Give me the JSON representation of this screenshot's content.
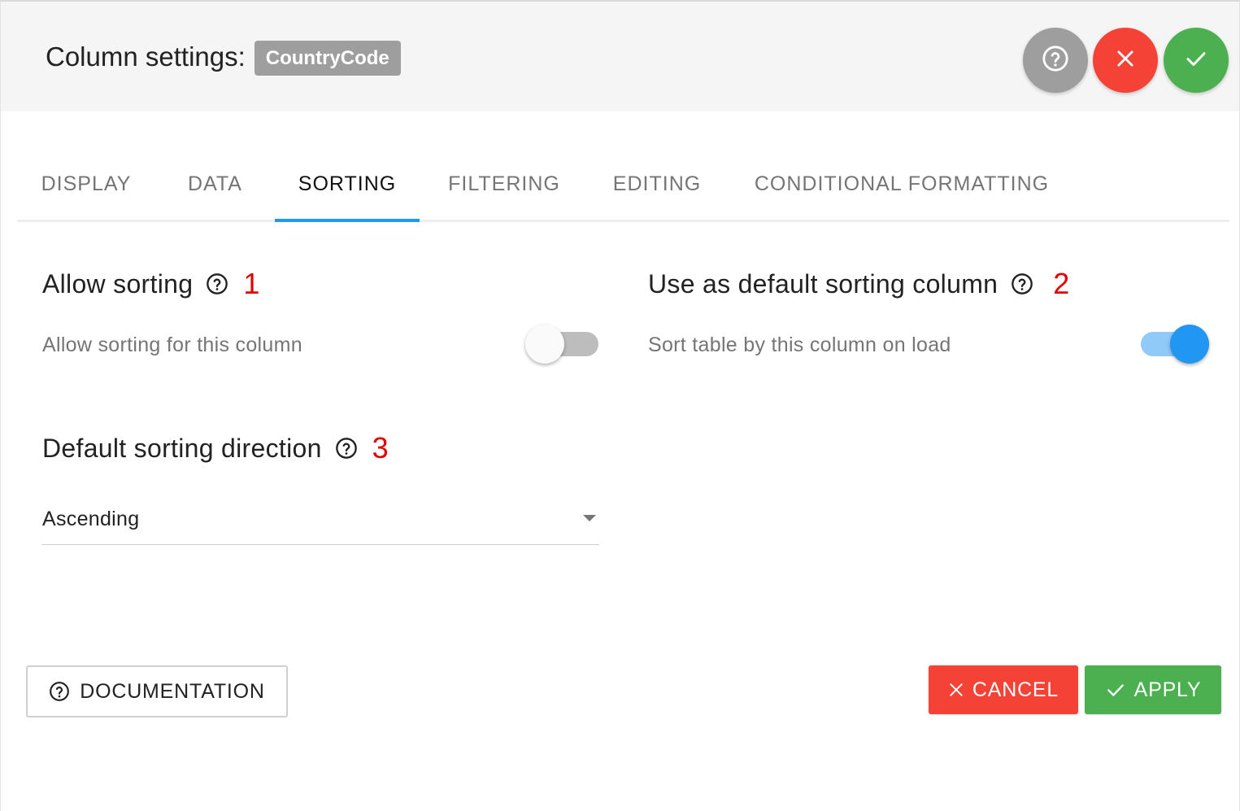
{
  "header": {
    "title": "Column settings:",
    "column_name": "CountryCode",
    "icons": [
      "help-icon",
      "close-icon",
      "check-icon"
    ]
  },
  "tabs": [
    {
      "label": "DISPLAY",
      "active": false
    },
    {
      "label": "DATA",
      "active": false
    },
    {
      "label": "SORTING",
      "active": true
    },
    {
      "label": "FILTERING",
      "active": false
    },
    {
      "label": "EDITING",
      "active": false
    },
    {
      "label": "CONDITIONAL FORMATTING",
      "active": false
    }
  ],
  "sections": {
    "allow_sorting": {
      "title": "Allow sorting",
      "marker": "1",
      "description": "Allow sorting for this column",
      "enabled": false
    },
    "default_sorting_column": {
      "title": "Use as default sorting column",
      "marker": "2",
      "description": "Sort table by this column on load",
      "enabled": true
    },
    "default_sorting_direction": {
      "title": "Default sorting direction",
      "marker": "3",
      "selected": "Ascending"
    }
  },
  "footer": {
    "documentation_label": "DOCUMENTATION",
    "cancel_label": "CANCEL",
    "apply_label": "APPLY"
  },
  "colors": {
    "accent": "#2196f3",
    "danger": "#f44336",
    "success": "#4caf50",
    "neutral": "#9e9e9e",
    "marker": "#e00000"
  }
}
